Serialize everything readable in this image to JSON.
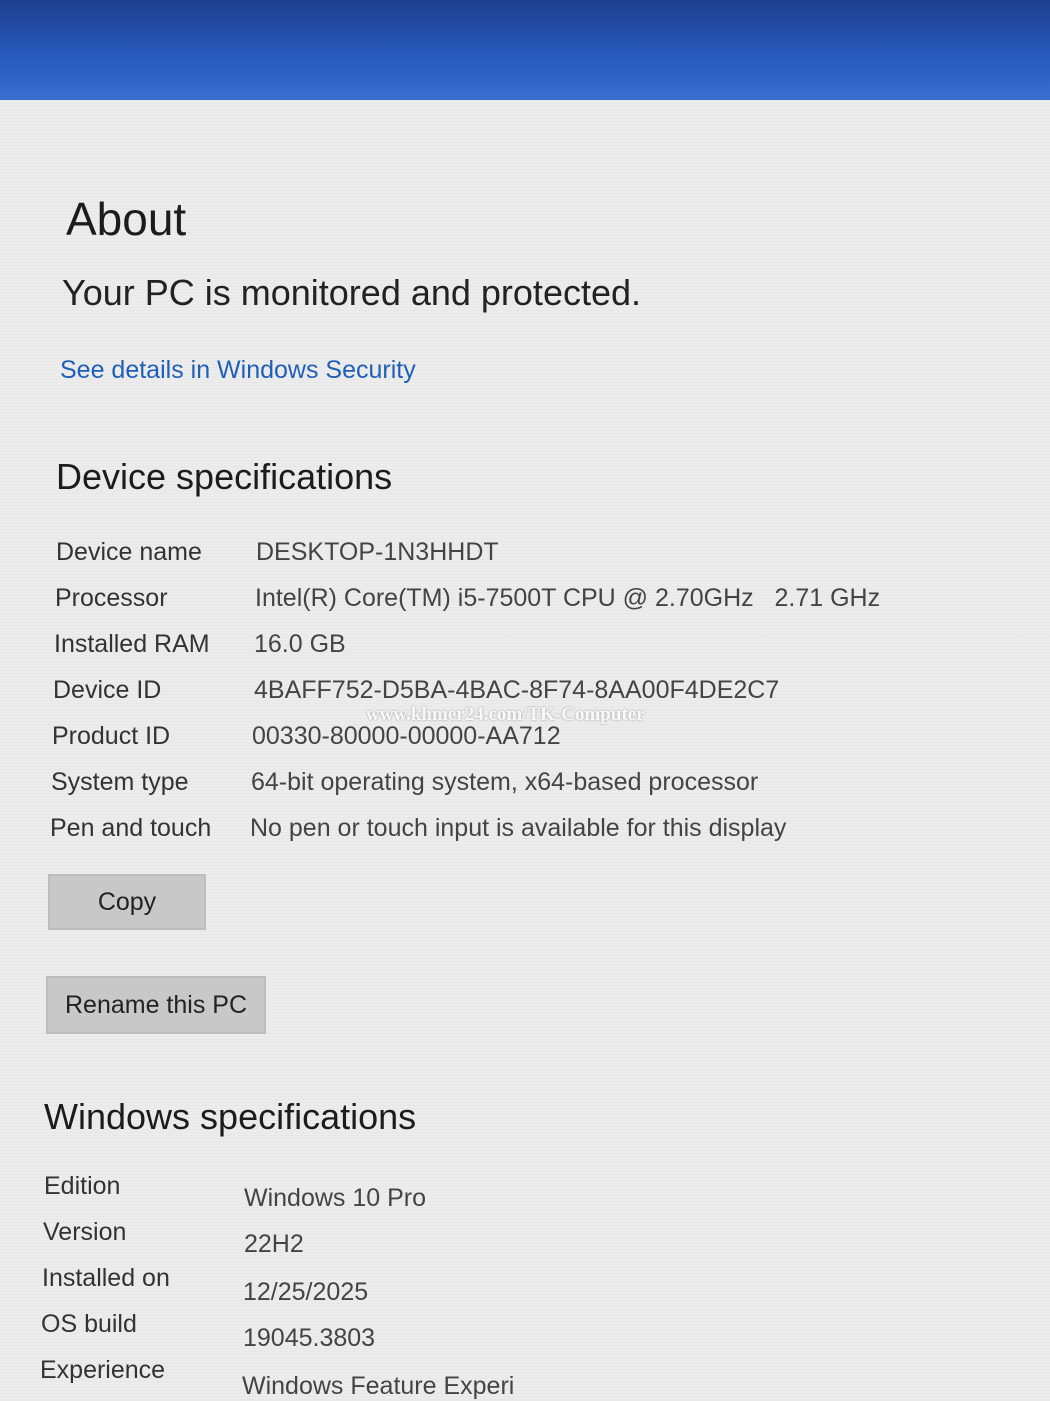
{
  "about": {
    "title": "About",
    "status": "Your PC is monitored and protected.",
    "security_link": "See details in Windows Security"
  },
  "device_specs": {
    "title": "Device specifications",
    "rows": [
      {
        "label": "Device name",
        "value": "DESKTOP-1N3HHDT"
      },
      {
        "label": "Processor",
        "value": "Intel(R) Core(TM) i5-7500T CPU @ 2.70GHz   2.71 GHz"
      },
      {
        "label": "Installed RAM",
        "value": "16.0 GB"
      },
      {
        "label": "Device ID",
        "value": "4BAFF752-D5BA-4BAC-8F74-8AA00F4DE2C7"
      },
      {
        "label": "Product ID",
        "value": "00330-80000-00000-AA712"
      },
      {
        "label": "System type",
        "value": "64-bit operating system, x64-based processor"
      },
      {
        "label": "Pen and touch",
        "value": "No pen or touch input is available for this display"
      }
    ],
    "copy_button": "Copy",
    "rename_button": "Rename this PC"
  },
  "windows_specs": {
    "title": "Windows specifications",
    "rows": [
      {
        "label": "Edition",
        "value": "Windows 10 Pro"
      },
      {
        "label": "Version",
        "value": "22H2"
      },
      {
        "label": "Installed on",
        "value": "12/25/2025"
      },
      {
        "label": "OS build",
        "value": "19045.3803"
      },
      {
        "label": "Experience",
        "value": "Windows Feature Experi"
      }
    ]
  },
  "watermark": "www.khmer24.com/TK-Computer",
  "colors": {
    "link": "#1f5fb8",
    "header_band": "#2a5bbf",
    "button_bg": "#c8c8c8"
  }
}
